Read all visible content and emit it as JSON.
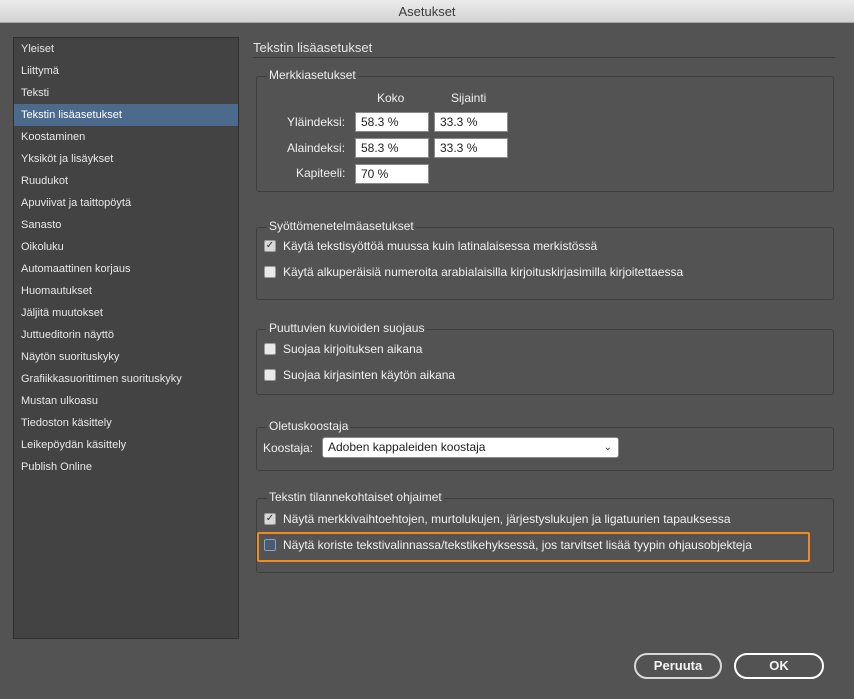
{
  "window": {
    "title": "Asetukset"
  },
  "sidebar": {
    "items": [
      "Yleiset",
      "Liittymä",
      "Teksti",
      "Tekstin lisäasetukset",
      "Koostaminen",
      "Yksiköt ja lisäykset",
      "Ruudukot",
      "Apuviivat ja taittopöytä",
      "Sanasto",
      "Oikoluku",
      "Automaattinen korjaus",
      "Huomautukset",
      "Jäljitä muutokset",
      "Juttueditorin näyttö",
      "Näytön suorituskyky",
      "Grafiikkasuorittimen suorituskyky",
      "Mustan ulkoasu",
      "Tiedoston käsittely",
      "Leikepöydän käsittely",
      "Publish Online"
    ],
    "selected_index": 3
  },
  "page": {
    "title": "Tekstin lisäasetukset"
  },
  "character": {
    "legend": "Merkkiasetukset",
    "col_size": "Koko",
    "col_position": "Sijainti",
    "superscript_label": "Yläindeksi:",
    "superscript_size": "58.3 %",
    "superscript_position": "33.3 %",
    "subscript_label": "Alaindeksi:",
    "subscript_size": "58.3 %",
    "subscript_position": "33.3 %",
    "smallcaps_label": "Kapiteeli:",
    "smallcaps_size": "70 %"
  },
  "input_method": {
    "legend": "Syöttömenetelmäasetukset",
    "opt1": "Käytä tekstisyöttöä muussa kuin latinalaisessa merkistössä",
    "opt1_checked": true,
    "opt2": "Käytä alkuperäisiä numeroita arabialaisilla kirjoituskirjasimilla kirjoitettaessa",
    "opt2_checked": false
  },
  "missing_glyph": {
    "legend": "Puuttuvien kuvioiden suojaus",
    "opt1": "Suojaa kirjoituksen aikana",
    "opt1_checked": false,
    "opt2": "Suojaa kirjasinten käytön aikana",
    "opt2_checked": false
  },
  "composer": {
    "legend": "Oletuskoostaja",
    "label": "Koostaja:",
    "value": "Adoben kappaleiden koostaja"
  },
  "contextual": {
    "legend": "Tekstin tilannekohtaiset ohjaimet",
    "opt1": "Näytä merkkivaihtoehtojen, murtolukujen, järjestyslukujen ja ligatuurien tapauksessa",
    "opt1_checked": true,
    "opt2": "Näytä koriste tekstivalinnassa/tekstikehyksessä, jos tarvitset lisää tyypin ohjausobjekteja",
    "opt2_checked": false
  },
  "buttons": {
    "cancel": "Peruuta",
    "ok": "OK"
  },
  "colors": {
    "selected": "#4c6a8c",
    "highlight": "#f08a1d",
    "background": "#535353"
  },
  "icons": {
    "checkmark": "check-icon",
    "dropdown": "chevron-down-icon"
  }
}
